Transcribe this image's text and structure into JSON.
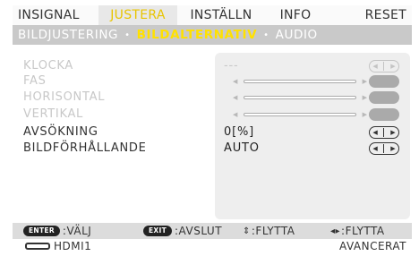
{
  "tabs": [
    {
      "label": "INSIGNAL",
      "active": false
    },
    {
      "label": "JUSTERA",
      "active": true
    },
    {
      "label": "INSTÄLLN",
      "active": false
    },
    {
      "label": "INFO",
      "active": false
    },
    {
      "label": "RESET",
      "active": false
    }
  ],
  "subtabs": [
    {
      "label": "BILDJUSTERING",
      "active": false
    },
    {
      "label": "BILDALTERNATIV",
      "active": true
    },
    {
      "label": "AUDIO",
      "active": false
    }
  ],
  "subtab_separator": "•",
  "menu": {
    "klocka": {
      "label": "KLOCKA",
      "value": "---",
      "enabled": false
    },
    "fas": {
      "label": "FAS",
      "enabled": false
    },
    "horisontal": {
      "label": "HORISONTAL",
      "enabled": false
    },
    "vertikal": {
      "label": "VERTIKAL",
      "enabled": false
    },
    "avsokning": {
      "label": "AVSÖKNING",
      "value": "0[%]",
      "enabled": true
    },
    "bildforhallande": {
      "label": "BILDFÖRHÅLLANDE",
      "value": "AUTO",
      "enabled": true
    }
  },
  "arrows": {
    "left": "◀",
    "right": "▶"
  },
  "help": {
    "enter_key": "ENTER",
    "enter_label": ":VÄLJ",
    "exit_key": "EXIT",
    "exit_label": ":AVSLUT",
    "move_glyph": "⇕",
    "move_label": ":FLYTTA",
    "adjust_glyph": "◂▸",
    "adjust_label": ":FLYTTA"
  },
  "status": {
    "source": "HDMI1",
    "mode": "AVANCERAT"
  },
  "colors": {
    "active_tab_text": "#e8c400",
    "active_subtab_text": "#ffe100",
    "subtab_bar": "#c9c9c9",
    "disabled_text": "#c8c8c8"
  }
}
